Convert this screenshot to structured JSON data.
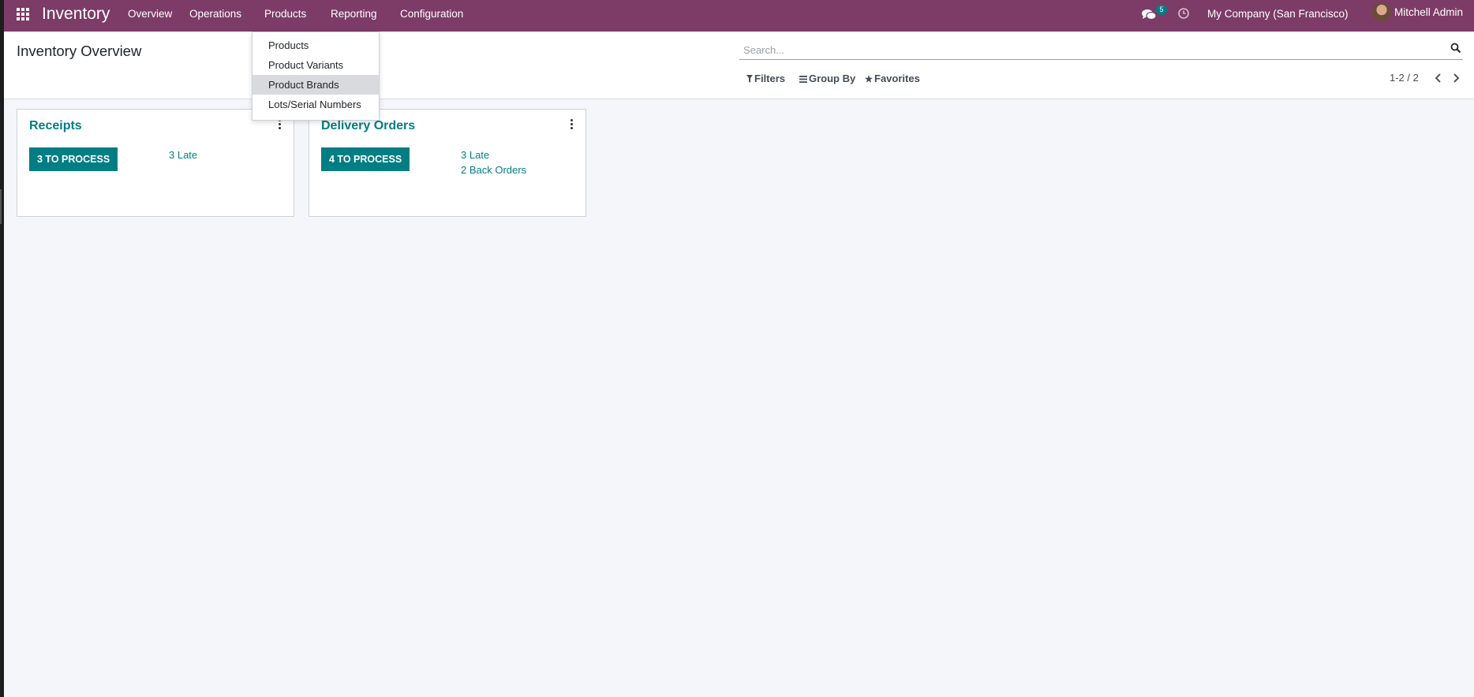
{
  "navbar": {
    "brand": "Inventory",
    "menu": [
      "Overview",
      "Operations",
      "Products",
      "Reporting",
      "Configuration"
    ],
    "chat_count": "5",
    "company": "My Company (San Francisco)",
    "user": "Mitchell Admin",
    "background": "#7c3c67"
  },
  "page": {
    "title": "Inventory Overview"
  },
  "search": {
    "placeholder": "Search..."
  },
  "filters": {
    "filters_label": "Filters",
    "group_by_label": "Group By",
    "favorites_label": "Favorites"
  },
  "pager": {
    "value": "1-2 / 2"
  },
  "dropdown": {
    "items": [
      "Products",
      "Product Variants",
      "Product Brands",
      "Lots/Serial Numbers"
    ],
    "active_item": "Product Brands"
  },
  "cards": [
    {
      "title": "Receipts",
      "process_label": "3 TO PROCESS",
      "links": [
        "3 Late"
      ]
    },
    {
      "title": "Delivery Orders",
      "process_label": "4 TO PROCESS",
      "links": [
        "3 Late",
        "2 Back Orders"
      ]
    }
  ],
  "icons": {
    "apps": "apps-grid-icon",
    "chat": "chat-icon",
    "activity": "clock-icon",
    "search": "search-icon",
    "filter": "funnel-icon",
    "group_by": "bars-icon",
    "favorites": "star-icon",
    "pager_prev": "chevron-left-icon",
    "pager_next": "chevron-right-icon",
    "card_menu": "kebab-icon"
  },
  "colors": {
    "brand": "#7c3c67",
    "accent": "#017e84"
  }
}
